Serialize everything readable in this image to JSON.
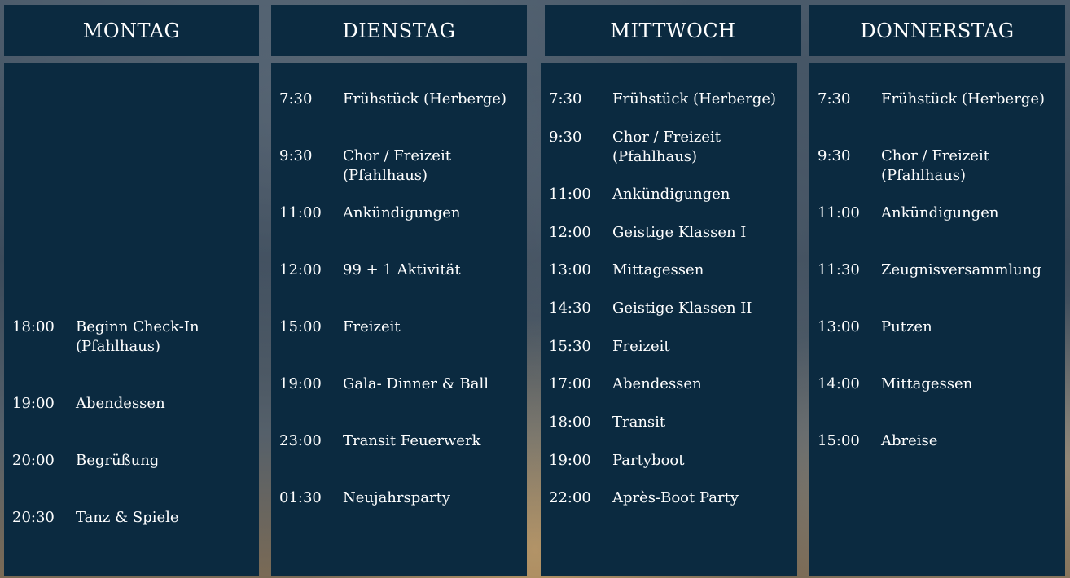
{
  "days": [
    {
      "name": "MONTAG",
      "events": [
        {
          "time": "18:00",
          "label": "Beginn Check-In (Pfahlhaus)"
        },
        {
          "time": "19:00",
          "label": "Abendessen"
        },
        {
          "time": "20:00",
          "label": "Begrüßung"
        },
        {
          "time": "20:30",
          "label": "Tanz & Spiele"
        }
      ]
    },
    {
      "name": "DIENSTAG",
      "events": [
        {
          "time": "7:30",
          "label": "Frühstück (Herberge)"
        },
        {
          "time": "9:30",
          "label": "Chor / Freizeit (Pfahlhaus)"
        },
        {
          "time": "11:00",
          "label": "Ankündigungen"
        },
        {
          "time": "12:00",
          "label": "99 + 1 Aktivität"
        },
        {
          "time": "15:00",
          "label": "Freizeit"
        },
        {
          "time": "19:00",
          "label": "Gala- Dinner & Ball"
        },
        {
          "time": "23:00",
          "label": "Transit Feuerwerk"
        },
        {
          "time": "01:30",
          "label": "Neujahrsparty"
        }
      ]
    },
    {
      "name": "MITTWOCH",
      "events": [
        {
          "time": "7:30",
          "label": "Frühstück (Herberge)"
        },
        {
          "time": "9:30",
          "label": "Chor / Freizeit (Pfahlhaus)"
        },
        {
          "time": "11:00",
          "label": "Ankündigungen"
        },
        {
          "time": "12:00",
          "label": "Geistige Klassen I"
        },
        {
          "time": "13:00",
          "label": "Mittagessen"
        },
        {
          "time": "14:30",
          "label": "Geistige Klassen II"
        },
        {
          "time": "15:30",
          "label": "Freizeit"
        },
        {
          "time": "17:00",
          "label": "Abendessen"
        },
        {
          "time": "18:00",
          "label": "Transit"
        },
        {
          "time": "19:00",
          "label": "Partyboot"
        },
        {
          "time": "22:00",
          "label": "Après-Boot Party"
        }
      ]
    },
    {
      "name": "DONNERSTAG",
      "events": [
        {
          "time": "7:30",
          "label": "Frühstück (Herberge)"
        },
        {
          "time": "9:30",
          "label": "Chor / Freizeit (Pfahlhaus)"
        },
        {
          "time": "11:00",
          "label": "Ankündigungen"
        },
        {
          "time": "11:30",
          "label": "Zeugnisversammlung"
        },
        {
          "time": "13:00",
          "label": "Putzen"
        },
        {
          "time": "14:00",
          "label": "Mittagessen"
        },
        {
          "time": "15:00",
          "label": "Abreise"
        }
      ]
    }
  ]
}
